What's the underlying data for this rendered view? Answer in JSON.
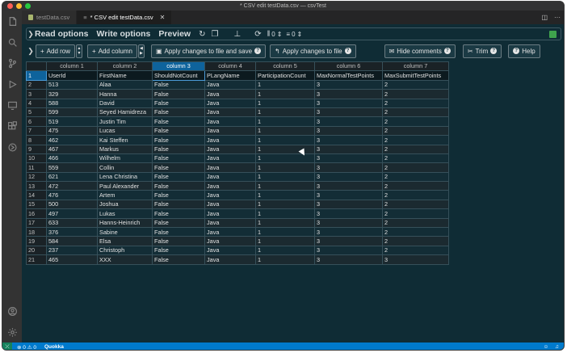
{
  "window": {
    "title": "* CSV edit testData.csv — csvTest",
    "traffic_colors": [
      "#ff5f57",
      "#febc2e",
      "#28c840"
    ]
  },
  "tabs": [
    {
      "label": "testData.csv",
      "active": false
    },
    {
      "label": "* CSV edit testData.csv",
      "active": true
    }
  ],
  "toolbar1": {
    "read_options": "Read options",
    "write_options": "Write options",
    "preview": "Preview",
    "fixed_rows_count": "0",
    "fixed_cols_count": "0"
  },
  "toolbar2": {
    "add_row": "Add row",
    "add_column": "Add column",
    "apply_save": "Apply changes to file and save",
    "apply": "Apply changes to file",
    "hide_comments": "Hide comments",
    "trim": "Trim",
    "help": "Help"
  },
  "grid": {
    "column_headers": [
      "column 1",
      "column 2",
      "column 3",
      "column 4",
      "column 5",
      "column 6",
      "column 7"
    ],
    "selected_column": 2,
    "rows": [
      [
        "1",
        "UserId",
        "FirstName",
        "ShouldNotCount",
        "PLangName",
        "ParticipationCount",
        "MaxNormalTestPoints",
        "MaxSubmitTestPoints"
      ],
      [
        "2",
        "513",
        "Alaa",
        "False",
        "Java",
        "1",
        "3",
        "2"
      ],
      [
        "3",
        "329",
        "Hanna",
        "False",
        "Java",
        "1",
        "3",
        "2"
      ],
      [
        "4",
        "588",
        "David",
        "False",
        "Java",
        "1",
        "3",
        "2"
      ],
      [
        "5",
        "599",
        "Seyed Hamidreza",
        "False",
        "Java",
        "1",
        "3",
        "2"
      ],
      [
        "6",
        "519",
        "Justin Tim",
        "False",
        "Java",
        "1",
        "3",
        "2"
      ],
      [
        "7",
        "475",
        "Lucas",
        "False",
        "Java",
        "1",
        "3",
        "2"
      ],
      [
        "8",
        "462",
        "Kai Steffen",
        "False",
        "Java",
        "1",
        "3",
        "2"
      ],
      [
        "9",
        "467",
        "Markus",
        "False",
        "Java",
        "1",
        "3",
        "2"
      ],
      [
        "10",
        "466",
        "Wilhelm",
        "False",
        "Java",
        "1",
        "3",
        "2"
      ],
      [
        "11",
        "559",
        "Collin",
        "False",
        "Java",
        "1",
        "3",
        "2"
      ],
      [
        "12",
        "621",
        "Lena Christina",
        "False",
        "Java",
        "1",
        "3",
        "2"
      ],
      [
        "13",
        "472",
        "Paul Alexander",
        "False",
        "Java",
        "1",
        "3",
        "2"
      ],
      [
        "14",
        "476",
        "Artem",
        "False",
        "Java",
        "1",
        "3",
        "2"
      ],
      [
        "15",
        "500",
        "Joshua",
        "False",
        "Java",
        "1",
        "3",
        "2"
      ],
      [
        "16",
        "497",
        "Lukas",
        "False",
        "Java",
        "1",
        "3",
        "2"
      ],
      [
        "17",
        "633",
        "Hanns-Heinrich",
        "False",
        "Java",
        "1",
        "3",
        "2"
      ],
      [
        "18",
        "376",
        "Sabine",
        "False",
        "Java",
        "1",
        "3",
        "2"
      ],
      [
        "19",
        "584",
        "Elsa",
        "False",
        "Java",
        "1",
        "3",
        "2"
      ],
      [
        "20",
        "237",
        "Christoph",
        "False",
        "Java",
        "1",
        "3",
        "2"
      ],
      [
        "21",
        "465",
        "XXX",
        "False",
        "Java",
        "1",
        "3",
        "3"
      ]
    ]
  },
  "status": {
    "errors": "0",
    "warnings": "0",
    "extension": "Quokka"
  }
}
